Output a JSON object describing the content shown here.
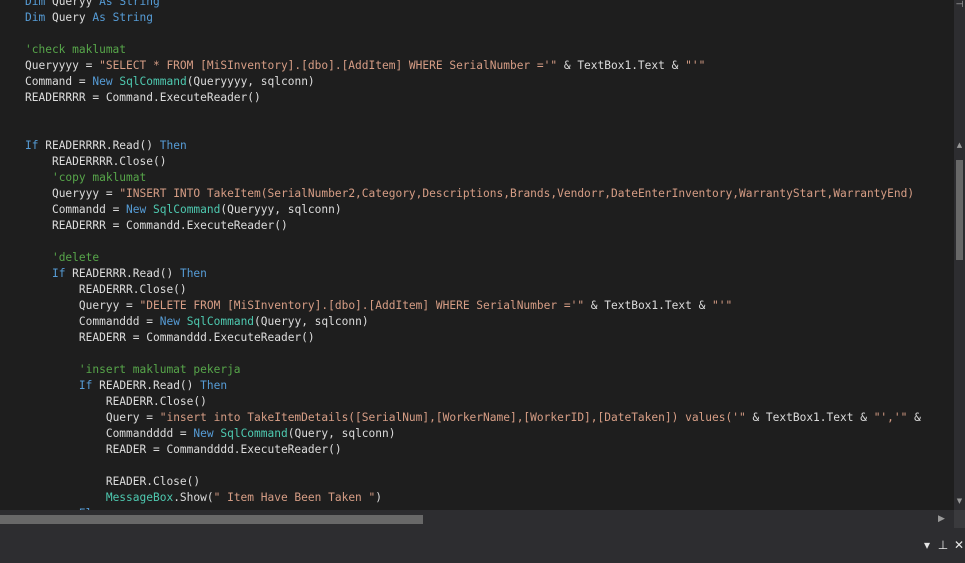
{
  "editor": {
    "colors": {
      "background": "#1e1e1e",
      "keyword": "#569cd6",
      "string": "#d69d85",
      "comment": "#57a64a",
      "type": "#4ec9b0",
      "plain": "#dcdcdc"
    },
    "lines": [
      {
        "indent": 0,
        "tokens": [
          {
            "t": "keyword",
            "v": "Dim"
          },
          {
            "t": "plain",
            "v": " Queryy "
          },
          {
            "t": "keyword",
            "v": "As"
          },
          {
            "t": "plain",
            "v": " "
          },
          {
            "t": "keyword",
            "v": "String"
          }
        ]
      },
      {
        "indent": 0,
        "tokens": [
          {
            "t": "keyword",
            "v": "Dim"
          },
          {
            "t": "plain",
            "v": " Query "
          },
          {
            "t": "keyword",
            "v": "As"
          },
          {
            "t": "plain",
            "v": " "
          },
          {
            "t": "keyword",
            "v": "String"
          }
        ]
      },
      {
        "indent": 0,
        "tokens": []
      },
      {
        "indent": 0,
        "tokens": [
          {
            "t": "comment",
            "v": "'check maklumat"
          }
        ]
      },
      {
        "indent": 0,
        "tokens": [
          {
            "t": "plain",
            "v": "Queryyyy = "
          },
          {
            "t": "string",
            "v": "\"SELECT * FROM [MiSInventory].[dbo].[AddItem] WHERE SerialNumber ='\""
          },
          {
            "t": "plain",
            "v": " & TextBox1.Text & "
          },
          {
            "t": "string",
            "v": "\"'\""
          }
        ]
      },
      {
        "indent": 0,
        "tokens": [
          {
            "t": "plain",
            "v": "Command = "
          },
          {
            "t": "keyword",
            "v": "New"
          },
          {
            "t": "plain",
            "v": " "
          },
          {
            "t": "type",
            "v": "SqlCommand"
          },
          {
            "t": "plain",
            "v": "(Queryyyy, sqlconn)"
          }
        ]
      },
      {
        "indent": 0,
        "tokens": [
          {
            "t": "plain",
            "v": "READERRRR = Command.ExecuteReader()"
          }
        ]
      },
      {
        "indent": 0,
        "tokens": []
      },
      {
        "indent": 0,
        "tokens": []
      },
      {
        "indent": 0,
        "tokens": [
          {
            "t": "keyword",
            "v": "If"
          },
          {
            "t": "plain",
            "v": " READERRRR.Read() "
          },
          {
            "t": "keyword",
            "v": "Then"
          }
        ]
      },
      {
        "indent": 4,
        "tokens": [
          {
            "t": "plain",
            "v": "READERRRR.Close()"
          }
        ]
      },
      {
        "indent": 4,
        "tokens": [
          {
            "t": "comment",
            "v": "'copy maklumat"
          }
        ]
      },
      {
        "indent": 4,
        "tokens": [
          {
            "t": "plain",
            "v": "Queryyy = "
          },
          {
            "t": "string",
            "v": "\"INSERT INTO TakeItem(SerialNumber2,Category,Descriptions,Brands,Vendorr,DateEnterInventory,WarrantyStart,WarrantyEnd)"
          }
        ]
      },
      {
        "indent": 4,
        "tokens": [
          {
            "t": "plain",
            "v": "Commandd = "
          },
          {
            "t": "keyword",
            "v": "New"
          },
          {
            "t": "plain",
            "v": " "
          },
          {
            "t": "type",
            "v": "SqlCommand"
          },
          {
            "t": "plain",
            "v": "(Queryyy, sqlconn)"
          }
        ]
      },
      {
        "indent": 4,
        "tokens": [
          {
            "t": "plain",
            "v": "READERRR = Commandd.ExecuteReader()"
          }
        ]
      },
      {
        "indent": 0,
        "tokens": []
      },
      {
        "indent": 4,
        "tokens": [
          {
            "t": "comment",
            "v": "'delete"
          }
        ]
      },
      {
        "indent": 4,
        "tokens": [
          {
            "t": "keyword",
            "v": "If"
          },
          {
            "t": "plain",
            "v": " READERRR.Read() "
          },
          {
            "t": "keyword",
            "v": "Then"
          }
        ]
      },
      {
        "indent": 8,
        "tokens": [
          {
            "t": "plain",
            "v": "READERRR.Close()"
          }
        ]
      },
      {
        "indent": 8,
        "tokens": [
          {
            "t": "plain",
            "v": "Queryy = "
          },
          {
            "t": "string",
            "v": "\"DELETE FROM [MiSInventory].[dbo].[AddItem] WHERE SerialNumber ='\""
          },
          {
            "t": "plain",
            "v": " & TextBox1.Text & "
          },
          {
            "t": "string",
            "v": "\"'\""
          }
        ]
      },
      {
        "indent": 8,
        "tokens": [
          {
            "t": "plain",
            "v": "Commanddd = "
          },
          {
            "t": "keyword",
            "v": "New"
          },
          {
            "t": "plain",
            "v": " "
          },
          {
            "t": "type",
            "v": "SqlCommand"
          },
          {
            "t": "plain",
            "v": "(Queryy, sqlconn)"
          }
        ]
      },
      {
        "indent": 8,
        "tokens": [
          {
            "t": "plain",
            "v": "READERR = Commanddd.ExecuteReader()"
          }
        ]
      },
      {
        "indent": 0,
        "tokens": []
      },
      {
        "indent": 8,
        "tokens": [
          {
            "t": "comment",
            "v": "'insert maklumat pekerja"
          }
        ]
      },
      {
        "indent": 8,
        "tokens": [
          {
            "t": "keyword",
            "v": "If"
          },
          {
            "t": "plain",
            "v": " READERR.Read() "
          },
          {
            "t": "keyword",
            "v": "Then"
          }
        ]
      },
      {
        "indent": 12,
        "tokens": [
          {
            "t": "plain",
            "v": "READERR.Close()"
          }
        ]
      },
      {
        "indent": 12,
        "tokens": [
          {
            "t": "plain",
            "v": "Query = "
          },
          {
            "t": "string",
            "v": "\"insert into TakeItemDetails([SerialNum],[WorkerName],[WorkerID],[DateTaken]) values('\""
          },
          {
            "t": "plain",
            "v": " & TextBox1.Text & "
          },
          {
            "t": "string",
            "v": "\"','\""
          },
          {
            "t": "plain",
            "v": " &"
          }
        ]
      },
      {
        "indent": 12,
        "tokens": [
          {
            "t": "plain",
            "v": "Commandddd = "
          },
          {
            "t": "keyword",
            "v": "New"
          },
          {
            "t": "plain",
            "v": " "
          },
          {
            "t": "type",
            "v": "SqlCommand"
          },
          {
            "t": "plain",
            "v": "(Query, sqlconn)"
          }
        ]
      },
      {
        "indent": 12,
        "tokens": [
          {
            "t": "plain",
            "v": "READER = Commandddd.ExecuteReader()"
          }
        ]
      },
      {
        "indent": 0,
        "tokens": []
      },
      {
        "indent": 12,
        "tokens": [
          {
            "t": "plain",
            "v": "READER.Close()"
          }
        ]
      },
      {
        "indent": 12,
        "tokens": [
          {
            "t": "type",
            "v": "MessageBox"
          },
          {
            "t": "plain",
            "v": ".Show("
          },
          {
            "t": "string",
            "v": "\" Item Have Been Taken \""
          },
          {
            "t": "plain",
            "v": ")"
          }
        ]
      },
      {
        "indent": 8,
        "tokens": [
          {
            "t": "keyword",
            "v": "El"
          }
        ]
      }
    ]
  },
  "scrollbars": {
    "vertical_corner_icon": "split-icon",
    "vertical_corner_glyph": "⊣",
    "vertical_up_glyph": "▲",
    "vertical_down_glyph": "▼",
    "horizontal_right_glyph": "▶"
  },
  "panel_bar": {
    "dropdown_icon": "chevron-down-icon",
    "dropdown_glyph": "▾",
    "pin_icon": "pin-icon",
    "pin_glyph": "⊥",
    "close_icon": "close-icon",
    "close_glyph": "✕"
  }
}
